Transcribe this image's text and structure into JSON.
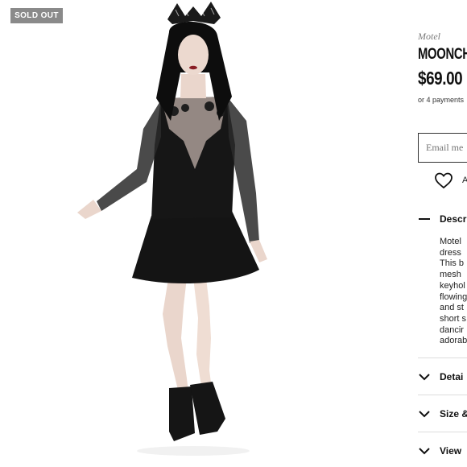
{
  "badge": {
    "label": "SOLD OUT"
  },
  "product": {
    "brand": "Motel",
    "title": "MOONCH",
    "price": "$69.00",
    "payments_text": "or 4 payments"
  },
  "email": {
    "placeholder": "Email me"
  },
  "wishlist": {
    "label": "A"
  },
  "description": {
    "label": "Descr",
    "lines": [
      "Motel",
      "dress",
      "This b",
      "mesh",
      "keyhol",
      "flowing",
      "and st",
      "short s",
      "dancir",
      "adorab"
    ]
  },
  "accordion": [
    {
      "label": "Detai"
    },
    {
      "label": "Size &"
    },
    {
      "label": "View"
    }
  ],
  "colors": {
    "badge_bg": "#8a8a8a",
    "dress": "#141414"
  }
}
